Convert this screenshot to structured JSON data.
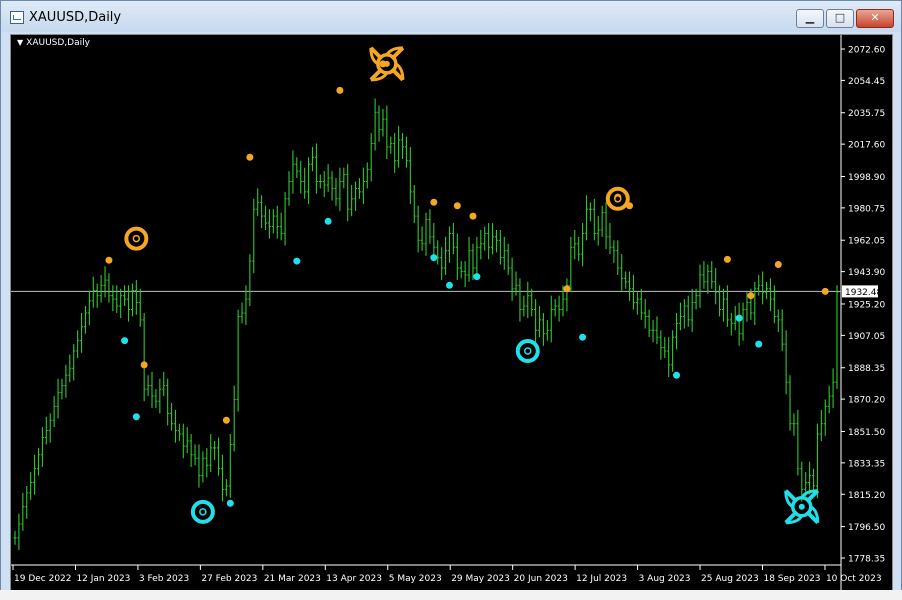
{
  "window": {
    "title": "XAUUSD,Daily",
    "controls": {
      "minimize": "▁",
      "maximize": "□",
      "close": "✕"
    }
  },
  "chart": {
    "label": "XAUUSD,Daily",
    "current_price_label": "1932.48"
  },
  "colors": {
    "background": "#000000",
    "candle": "#2ec82e",
    "high_marker": "#f5a623",
    "low_marker": "#1fe0e8",
    "axis_text": "#ffffff",
    "price_line": "#c0c0c0"
  },
  "chart_data": {
    "type": "line",
    "title": "XAUUSD,Daily",
    "y_ticks": [
      "2072.60",
      "2054.45",
      "2035.75",
      "2017.60",
      "1998.90",
      "1980.75",
      "1962.05",
      "1943.90",
      "1925.20",
      "1907.05",
      "1888.35",
      "1870.20",
      "1851.50",
      "1833.35",
      "1815.20",
      "1796.50",
      "1778.35"
    ],
    "x_ticks": [
      "19 Dec 2022",
      "12 Jan 2023",
      "3 Feb 2023",
      "27 Feb 2023",
      "21 Mar 2023",
      "13 Apr 2023",
      "5 May 2023",
      "29 May 2023",
      "20 Jun 2023",
      "12 Jul 2023",
      "3 Aug 2023",
      "25 Aug 2023",
      "18 Sep 2023",
      "10 Oct 2023"
    ],
    "ylim": [
      1778.35,
      2072.6
    ],
    "current_price": 1932.48,
    "series": [
      {
        "values": [
          1790,
          1798,
          1808,
          1816,
          1822,
          1830,
          1838,
          1848,
          1852,
          1858,
          1866,
          1874,
          1878,
          1884,
          1888,
          1898,
          1904,
          1912,
          1920,
          1927,
          1933,
          1930,
          1936,
          1939,
          1930,
          1928,
          1924,
          1930,
          1928,
          1922,
          1933,
          1926,
          1916,
          1876,
          1878,
          1872,
          1869,
          1876,
          1878,
          1862,
          1856,
          1852,
          1850,
          1843,
          1846,
          1838,
          1836,
          1826,
          1836,
          1832,
          1842,
          1842,
          1830,
          1818,
          1820,
          1844,
          1870,
          1918,
          1920,
          1928,
          1950,
          1980,
          1984,
          1976,
          1972,
          1970,
          1976,
          1970,
          1966,
          1986,
          1996,
          2006,
          2002,
          1996,
          1990,
          2006,
          2010,
          1996,
          1996,
          1994,
          1998,
          1992,
          1986,
          1996,
          2000,
          1980,
          1986,
          1992,
          1990,
          1996,
          2003,
          2018,
          2036,
          2026,
          2032,
          2016,
          2018,
          2008,
          2020,
          2016,
          2008,
          1990,
          1976,
          1962,
          1960,
          1974,
          1964,
          1958,
          1952,
          1946,
          1956,
          1966,
          1958,
          1946,
          1944,
          1942,
          1956,
          1946,
          1958,
          1960,
          1966,
          1958,
          1964,
          1962,
          1952,
          1956,
          1946,
          1934,
          1936,
          1922,
          1924,
          1930,
          1922,
          1910,
          1916,
          1908,
          1910,
          1922,
          1924,
          1922,
          1928,
          1936,
          1958,
          1960,
          1954,
          1966,
          1980,
          1980,
          1966,
          1968,
          1978,
          1964,
          1958,
          1956,
          1946,
          1940,
          1938,
          1934,
          1926,
          1928,
          1920,
          1918,
          1910,
          1910,
          1906,
          1900,
          1898,
          1890,
          1906,
          1914,
          1918,
          1924,
          1916,
          1926,
          1930,
          1942,
          1938,
          1944,
          1938,
          1932,
          1922,
          1928,
          1916,
          1914,
          1918,
          1908,
          1922,
          1926,
          1920,
          1934,
          1936,
          1932,
          1934,
          1928,
          1918,
          1916,
          1902,
          1880,
          1856,
          1856,
          1830,
          1818,
          1822,
          1826,
          1820,
          1850,
          1856,
          1866,
          1872,
          1880,
          1932
        ]
      }
    ],
    "swing_highs": [
      [
        24,
        1950.5
      ],
      [
        33,
        1890
      ],
      [
        54,
        1858
      ],
      [
        60,
        2010
      ],
      [
        83,
        2048.7
      ],
      [
        94,
        2064
      ],
      [
        107,
        1984
      ],
      [
        113,
        1982
      ],
      [
        117,
        1976
      ],
      [
        141,
        1934
      ],
      [
        154,
        1987
      ],
      [
        157,
        1982
      ],
      [
        182,
        1951
      ],
      [
        188,
        1930
      ],
      [
        195,
        1948
      ],
      [
        207,
        1932.5
      ]
    ],
    "swing_lows": [
      [
        28,
        1904
      ],
      [
        31,
        1860
      ],
      [
        55,
        1810
      ],
      [
        72,
        1950
      ],
      [
        80,
        1973
      ],
      [
        107,
        1952
      ],
      [
        111,
        1936
      ],
      [
        118,
        1941
      ],
      [
        145,
        1906
      ],
      [
        169,
        1884
      ],
      [
        185,
        1917
      ],
      [
        190,
        1902
      ]
    ],
    "major_rings": [
      {
        "type": "high",
        "i": 31,
        "v": 1963
      },
      {
        "type": "low",
        "i": 48,
        "v": 1805
      },
      {
        "type": "low",
        "i": 131,
        "v": 1898
      },
      {
        "type": "high",
        "i": 154,
        "v": 1986
      }
    ],
    "major_stars": [
      {
        "type": "high",
        "i": 95,
        "v": 2064
      },
      {
        "type": "low",
        "i": 201,
        "v": 1808
      }
    ]
  }
}
